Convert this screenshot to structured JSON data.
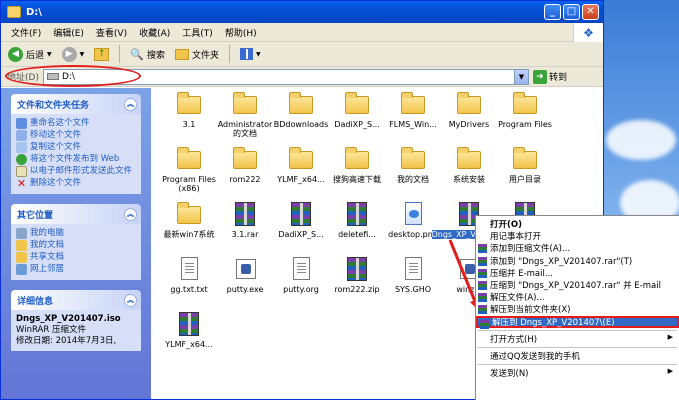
{
  "window": {
    "title": "D:\\"
  },
  "title_buttons": {
    "minimize": "_",
    "maximize": "□",
    "close": "✕"
  },
  "menu": [
    "文件(F)",
    "编辑(E)",
    "查看(V)",
    "收藏(A)",
    "工具(T)",
    "帮助(H)"
  ],
  "toolbar": {
    "back": "后退",
    "search": "搜索",
    "folders": "文件夹"
  },
  "address": {
    "label": "地址(D)",
    "value": "D:\\",
    "go": "转到"
  },
  "tasks": {
    "title": "文件和文件夹任务",
    "items": [
      "重命名这个文件",
      "移动这个文件",
      "复制这个文件",
      "将这个文件发布到 Web",
      "以电子邮件形式发送此文件",
      "删除这个文件"
    ]
  },
  "places": {
    "title": "其它位置",
    "items": [
      "我的电脑",
      "我的文档",
      "共享文档",
      "网上邻居"
    ]
  },
  "details": {
    "title": "详细信息",
    "name": "Dngs_XP_V201407.iso",
    "type": "WinRAR 压缩文件",
    "date": "修改日期: 2014年7月3日,"
  },
  "files": [
    {
      "name": "3.1",
      "type": "folder"
    },
    {
      "name": "Administrator的文档",
      "type": "folder"
    },
    {
      "name": "BDdownloads",
      "type": "folder"
    },
    {
      "name": "DadiXP_S...",
      "type": "folder"
    },
    {
      "name": "FLMS_Win...",
      "type": "folder"
    },
    {
      "name": "MyDrivers",
      "type": "folder"
    },
    {
      "name": "Program Files",
      "type": "folder"
    },
    {
      "name": "Program Files (x86)",
      "type": "folder"
    },
    {
      "name": "rom222",
      "type": "folder"
    },
    {
      "name": "YLMF_x64...",
      "type": "folder"
    },
    {
      "name": "搜狗高速下载",
      "type": "folder"
    },
    {
      "name": "我的文档",
      "type": "folder"
    },
    {
      "name": "系统安装",
      "type": "folder"
    },
    {
      "name": "用户目录",
      "type": "folder"
    },
    {
      "name": "最新win7系统",
      "type": "folder"
    },
    {
      "name": "3.1.rar",
      "type": "rar"
    },
    {
      "name": "DadiXP_S...",
      "type": "rar"
    },
    {
      "name": "deletefi...",
      "type": "rar"
    },
    {
      "name": "desktop.png",
      "type": "png"
    },
    {
      "name": "Dngs_XP_V201407",
      "type": "rar",
      "selected": true
    },
    {
      "name": "",
      "type": "rar"
    },
    {
      "name": "gg.txt.txt",
      "type": "doc"
    },
    {
      "name": "putty.exe",
      "type": "exe"
    },
    {
      "name": "putty.org",
      "type": "doc"
    },
    {
      "name": "rom222.zip",
      "type": "rar"
    },
    {
      "name": "SYS.GHO",
      "type": "doc"
    },
    {
      "name": "winzip",
      "type": "exe"
    },
    {
      "name": "",
      "type": "none"
    },
    {
      "name": "YLMF_x64...",
      "type": "rar"
    }
  ],
  "context_menu": [
    {
      "label": "打开(O)",
      "bold": true
    },
    {
      "label": "用记事本打开"
    },
    {
      "label": "添加到压缩文件(A)...",
      "icon": true
    },
    {
      "label": "添加到 \"Dngs_XP_V201407.rar\"(T)",
      "icon": true
    },
    {
      "label": "压缩并 E-mail...",
      "icon": true
    },
    {
      "label": "压缩到 \"Dngs_XP_V201407.rar\" 并 E-mail",
      "icon": true
    },
    {
      "label": "解压文件(A)...",
      "icon": true
    },
    {
      "label": "解压到当前文件夹(X)",
      "icon": true
    },
    {
      "label": "解压到 Dngs_XP_V201407\\(E)",
      "icon": true,
      "highlight": true
    },
    {
      "sep": true
    },
    {
      "label": "打开方式(H)",
      "arrow": true
    },
    {
      "sep": true
    },
    {
      "label": "通过QQ发送到我的手机"
    },
    {
      "sep": true
    },
    {
      "label": "发送到(N)",
      "arrow": true
    }
  ],
  "colors": {
    "titlebar": "#0a61ee",
    "taskpane": "#7ba2e7",
    "highlight": "#316ac5",
    "annotation": "#e21b1b"
  }
}
